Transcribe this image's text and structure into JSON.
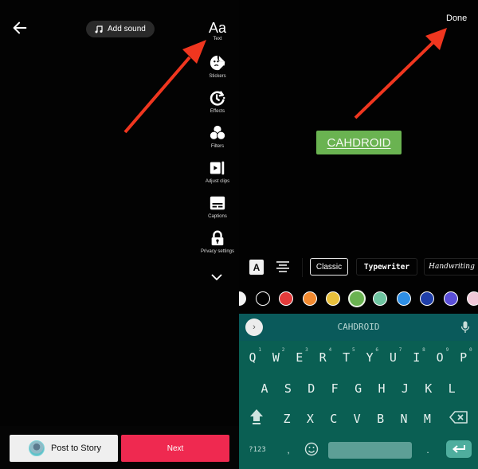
{
  "left": {
    "back_icon": "arrow-left-icon",
    "add_sound_label": "Add sound",
    "tools": [
      {
        "id": "text",
        "label": "Text",
        "glyph": "Aa",
        "icon": "text-aa-icon"
      },
      {
        "id": "stickers",
        "label": "Stickers",
        "icon": "sticker-icon"
      },
      {
        "id": "effects",
        "label": "Effects",
        "icon": "effects-timer-icon"
      },
      {
        "id": "filters",
        "label": "Filters",
        "icon": "filters-circles-icon"
      },
      {
        "id": "adjust_clips",
        "label": "Adjust clips",
        "icon": "adjust-clips-icon"
      },
      {
        "id": "captions",
        "label": "Captions",
        "icon": "captions-icon"
      },
      {
        "id": "privacy",
        "label": "Privacy settings",
        "icon": "lock-icon"
      }
    ],
    "more_icon": "chevron-down-icon",
    "post_to_story_label": "Post to Story",
    "next_label": "Next"
  },
  "right": {
    "done_label": "Done",
    "text_overlay": "CAHDROID",
    "text_bg_color": "#6ab351",
    "style_buttons": {
      "text_bg_toggle": "A",
      "align_icon": "align-center-icon"
    },
    "fonts": [
      {
        "label": "Classic",
        "selected": true
      },
      {
        "label": "Typewriter",
        "selected": false
      },
      {
        "label": "Handwriting",
        "selected": false
      }
    ],
    "colors": [
      {
        "hex": "#f2f2f2",
        "name": "white"
      },
      {
        "hex": "#000000",
        "name": "black"
      },
      {
        "hex": "#e23b3b",
        "name": "red"
      },
      {
        "hex": "#f28a30",
        "name": "orange"
      },
      {
        "hex": "#e8c03c",
        "name": "yellow"
      },
      {
        "hex": "#6ab351",
        "name": "green",
        "selected": true
      },
      {
        "hex": "#6ec4a0",
        "name": "teal"
      },
      {
        "hex": "#2e8fe6",
        "name": "blue"
      },
      {
        "hex": "#1f3ea8",
        "name": "dark-blue"
      },
      {
        "hex": "#5b4fd8",
        "name": "purple"
      },
      {
        "hex": "#f0c8d8",
        "name": "pink"
      }
    ],
    "keyboard": {
      "suggestion": "CAHDROID",
      "row1": [
        {
          "k": "Q",
          "n": "1"
        },
        {
          "k": "W",
          "n": "2"
        },
        {
          "k": "E",
          "n": "3"
        },
        {
          "k": "R",
          "n": "4"
        },
        {
          "k": "T",
          "n": "5"
        },
        {
          "k": "Y",
          "n": "6"
        },
        {
          "k": "U",
          "n": "7"
        },
        {
          "k": "I",
          "n": "8"
        },
        {
          "k": "O",
          "n": "9"
        },
        {
          "k": "P",
          "n": "0"
        }
      ],
      "row2": [
        "A",
        "S",
        "D",
        "F",
        "G",
        "H",
        "J",
        "K",
        "L"
      ],
      "row3": [
        "Z",
        "X",
        "C",
        "V",
        "B",
        "N",
        "M"
      ],
      "sym_label": "?123",
      "comma": ",",
      "period": "."
    }
  },
  "annotation_color": "#f0361f"
}
